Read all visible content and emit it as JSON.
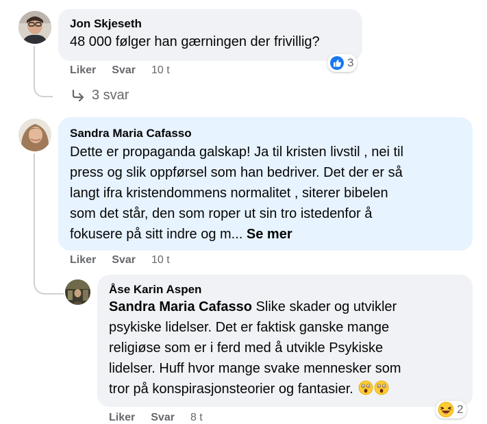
{
  "comments": [
    {
      "author": "Jon Skjeseth",
      "lines": [
        "48 000 følger han gærningen der frivillig?"
      ],
      "actions": {
        "like": "Liker",
        "reply": "Svar",
        "time": "10 t"
      },
      "reaction": {
        "type": "like",
        "count": "3"
      },
      "replies_link": "3 svar"
    },
    {
      "author": "Sandra Maria Cafasso",
      "lines": [
        "Dette er propaganda galskap! Ja til kristen livstil , nei til",
        "press og slik oppførsel som han bedriver. Det der er så",
        "langt ifra kristendommens normalitet , siterer bibelen",
        "som det står, den som roper ut sin tro istedenfor å",
        "fokusere på sitt indre og m..."
      ],
      "see_more": "Se mer",
      "actions": {
        "like": "Liker",
        "reply": "Svar",
        "time": "10 t"
      }
    },
    {
      "author": "Åse Karin Aspen",
      "mention": "Sandra Maria Cafasso",
      "lines": [
        " Slike skader og utvikler",
        "psykiske lidelser. Det er faktisk ganske mange",
        "religiøse som er i ferd med å utvikle Psykiske",
        "lidelser. Huff hvor mange svake mennesker som",
        "tror på konspirasjonsteorier og fantasier."
      ],
      "emojis": [
        "astonished-face",
        "astonished-face"
      ],
      "actions": {
        "like": "Liker",
        "reply": "Svar",
        "time": "8 t"
      },
      "reaction": {
        "type": "laugh",
        "count": "2"
      }
    }
  ]
}
